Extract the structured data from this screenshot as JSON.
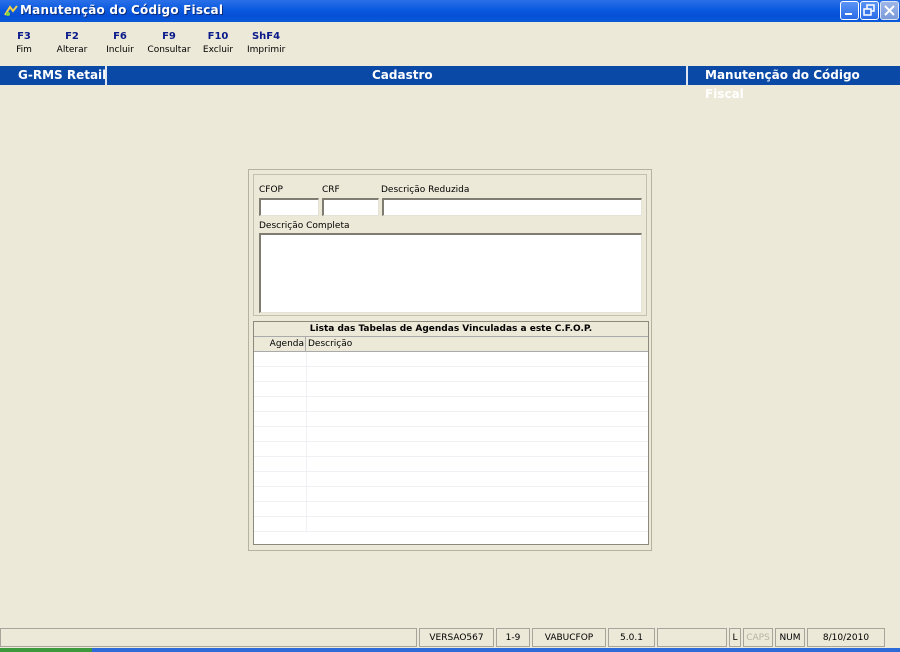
{
  "window": {
    "title": "Manutenção do Código Fiscal",
    "app_icon": "app-icon"
  },
  "toolbar": {
    "keys": [
      {
        "key": "F3",
        "label": "Fim"
      },
      {
        "key": "F2",
        "label": "Alterar"
      },
      {
        "key": "F6",
        "label": "Incluir"
      },
      {
        "key": "F9",
        "label": "Consultar"
      },
      {
        "key": "F10",
        "label": "Excluir"
      },
      {
        "key": "ShF4",
        "label": "Imprimir"
      }
    ]
  },
  "band": {
    "left": "G-RMS Retail",
    "center": "Cadastro",
    "right": "Manutenção do Código Fiscal"
  },
  "form": {
    "cfop_label": "CFOP",
    "crf_label": "CRF",
    "desc_reduzida_label": "Descrição Reduzida",
    "desc_completa_label": "Descrição Completa",
    "cfop_value": "",
    "crf_value": "",
    "desc_reduzida_value": "",
    "desc_completa_value": ""
  },
  "list": {
    "title": "Lista das Tabelas de Agendas Vinculadas a este C.F.O.P.",
    "columns": [
      "Agenda",
      "Descrição"
    ],
    "rows": []
  },
  "status": {
    "panels": [
      "VERSAO567",
      "1-9",
      "VABUCFOP",
      "5.0.1",
      "L",
      "CAPS",
      "NUM",
      "8/10/2010"
    ]
  },
  "colors": {
    "band": "#0a4aa6",
    "titlebar": "#0a5ae0",
    "face": "#ece9d8"
  }
}
